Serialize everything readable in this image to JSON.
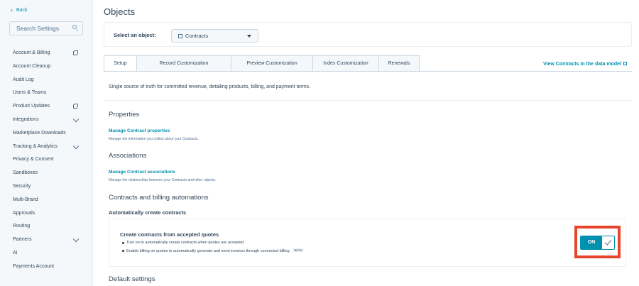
{
  "sidebar": {
    "back_label": "Back",
    "search_placeholder": "Search Settings",
    "items": [
      {
        "label": "Account & Billing",
        "icon": "external-link-icon"
      },
      {
        "label": "Account Cleanup"
      },
      {
        "label": "Audit Log"
      },
      {
        "label": "Users & Teams"
      },
      {
        "label": "Product Updates",
        "icon": "external-link-icon"
      },
      {
        "label": "Integrations",
        "icon": "chevron-down-icon"
      },
      {
        "label": "Marketplace Downloads"
      },
      {
        "label": "Tracking & Analytics",
        "icon": "chevron-down-icon"
      },
      {
        "label": "Privacy & Consent"
      },
      {
        "label": "Sandboxes"
      },
      {
        "label": "Security"
      },
      {
        "label": "Multi-Brand"
      },
      {
        "label": "Approvals"
      },
      {
        "label": "Routing"
      },
      {
        "label": "Partners",
        "icon": "chevron-down-icon"
      },
      {
        "label": "AI"
      },
      {
        "label": "Payments Account"
      }
    ]
  },
  "header": {
    "title": "Objects",
    "select_label": "Select an object:",
    "selected_object": "Contracts"
  },
  "tabs": [
    {
      "label": "Setup",
      "active": true
    },
    {
      "label": "Record Customization"
    },
    {
      "label": "Preview Customization"
    },
    {
      "label": "Index Customization"
    },
    {
      "label": "Renewals"
    }
  ],
  "view_link": "View Contracts in the data model",
  "setup": {
    "description": "Single source of truth for committed revenue, detailing products, billing, and payment terms.",
    "properties_heading": "Properties",
    "properties_link": "Manage Contract properties",
    "properties_sub": "Manage the information you collect about your Contracts.",
    "associations_heading": "Associations",
    "associations_link": "Manage Contract associations",
    "associations_sub": "Manage the relationships between your Contracts and other objects.",
    "automations_heading": "Contracts and billing automations",
    "auto_create_heading": "Automatically create contracts",
    "auto_box_title": "Create contracts from accepted quotes",
    "bullet_1": "Turn on to automatically create contracts when quotes are accepted",
    "bullet_2": "Enable billing on quotes to automatically generate and send invoices through connected billing",
    "beta_badge": "BETA",
    "toggle_label": "ON",
    "toggle_state": "on",
    "default_heading": "Default settings"
  },
  "colors": {
    "accent": "#0091ae",
    "highlight": "#e8462c"
  }
}
